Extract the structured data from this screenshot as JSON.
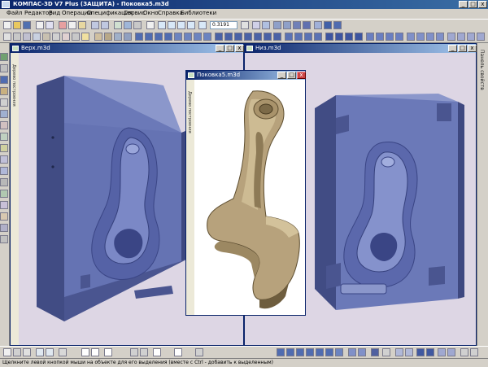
{
  "window": {
    "title": "КОМПАС-3D V7 Plus (ЗАЩИТА) - Поковка5.m3d",
    "minimize": "_",
    "maximize": "□",
    "close": "x"
  },
  "menu": [
    "Файл",
    "Редактор",
    "Вид",
    "Операции",
    "Спецификация",
    "Сервис",
    "Окно",
    "Справка",
    "Библиотеки"
  ],
  "toolbar": {
    "zoom_value": "0.3191"
  },
  "right_panel": {
    "label": "Панель свойств"
  },
  "documents": {
    "left": {
      "title": "Верх.m3d",
      "tree_label": "Дерево построения"
    },
    "center": {
      "title": "Поковка5.m3d",
      "tree_label": "Дерево построения"
    },
    "right": {
      "title": "Низ.m3d"
    }
  },
  "status": {
    "text": "Щелкните левой кнопкой мыши на объекте для его выделения (вместе с Ctrl - добавить к выделенным)"
  },
  "colors": {
    "title_active": "#0a246a",
    "mold_face": "#6b79b8",
    "forging": "#b7a27c",
    "viewport": "#ddd6e4"
  }
}
